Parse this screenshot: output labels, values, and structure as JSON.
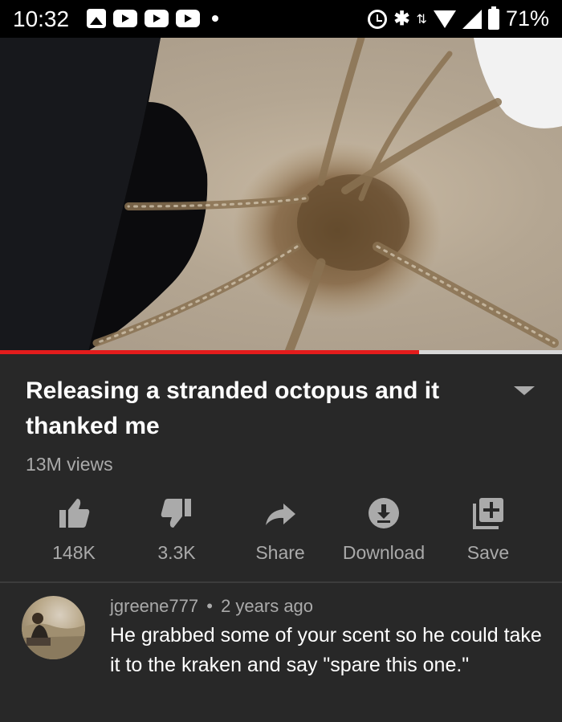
{
  "status_bar": {
    "time": "10:32",
    "battery_percent": "71%",
    "icons": [
      "image-icon",
      "youtube-icon",
      "youtube-icon",
      "youtube-icon",
      "dot-icon",
      "alarm-icon",
      "bluetooth-icon",
      "data-arrows-icon",
      "wifi-icon",
      "signal-icon",
      "battery-icon"
    ]
  },
  "video": {
    "progress": 0.745,
    "progress_color": "#e31c1c"
  },
  "info": {
    "title": "Releasing a stranded octopus and it thanked me",
    "views": "13M views"
  },
  "actions": [
    {
      "icon": "thumbs-up-icon",
      "label": "148K"
    },
    {
      "icon": "thumbs-down-icon",
      "label": "3.3K"
    },
    {
      "icon": "share-icon",
      "label": "Share"
    },
    {
      "icon": "download-icon",
      "label": "Download"
    },
    {
      "icon": "save-to-playlist-icon",
      "label": "Save"
    }
  ],
  "comment": {
    "author": "jgreene777",
    "separator": "•",
    "time_ago": "2 years ago",
    "text": "He grabbed some of your scent so he could take it to the kraken and say \"spare this one.\""
  }
}
